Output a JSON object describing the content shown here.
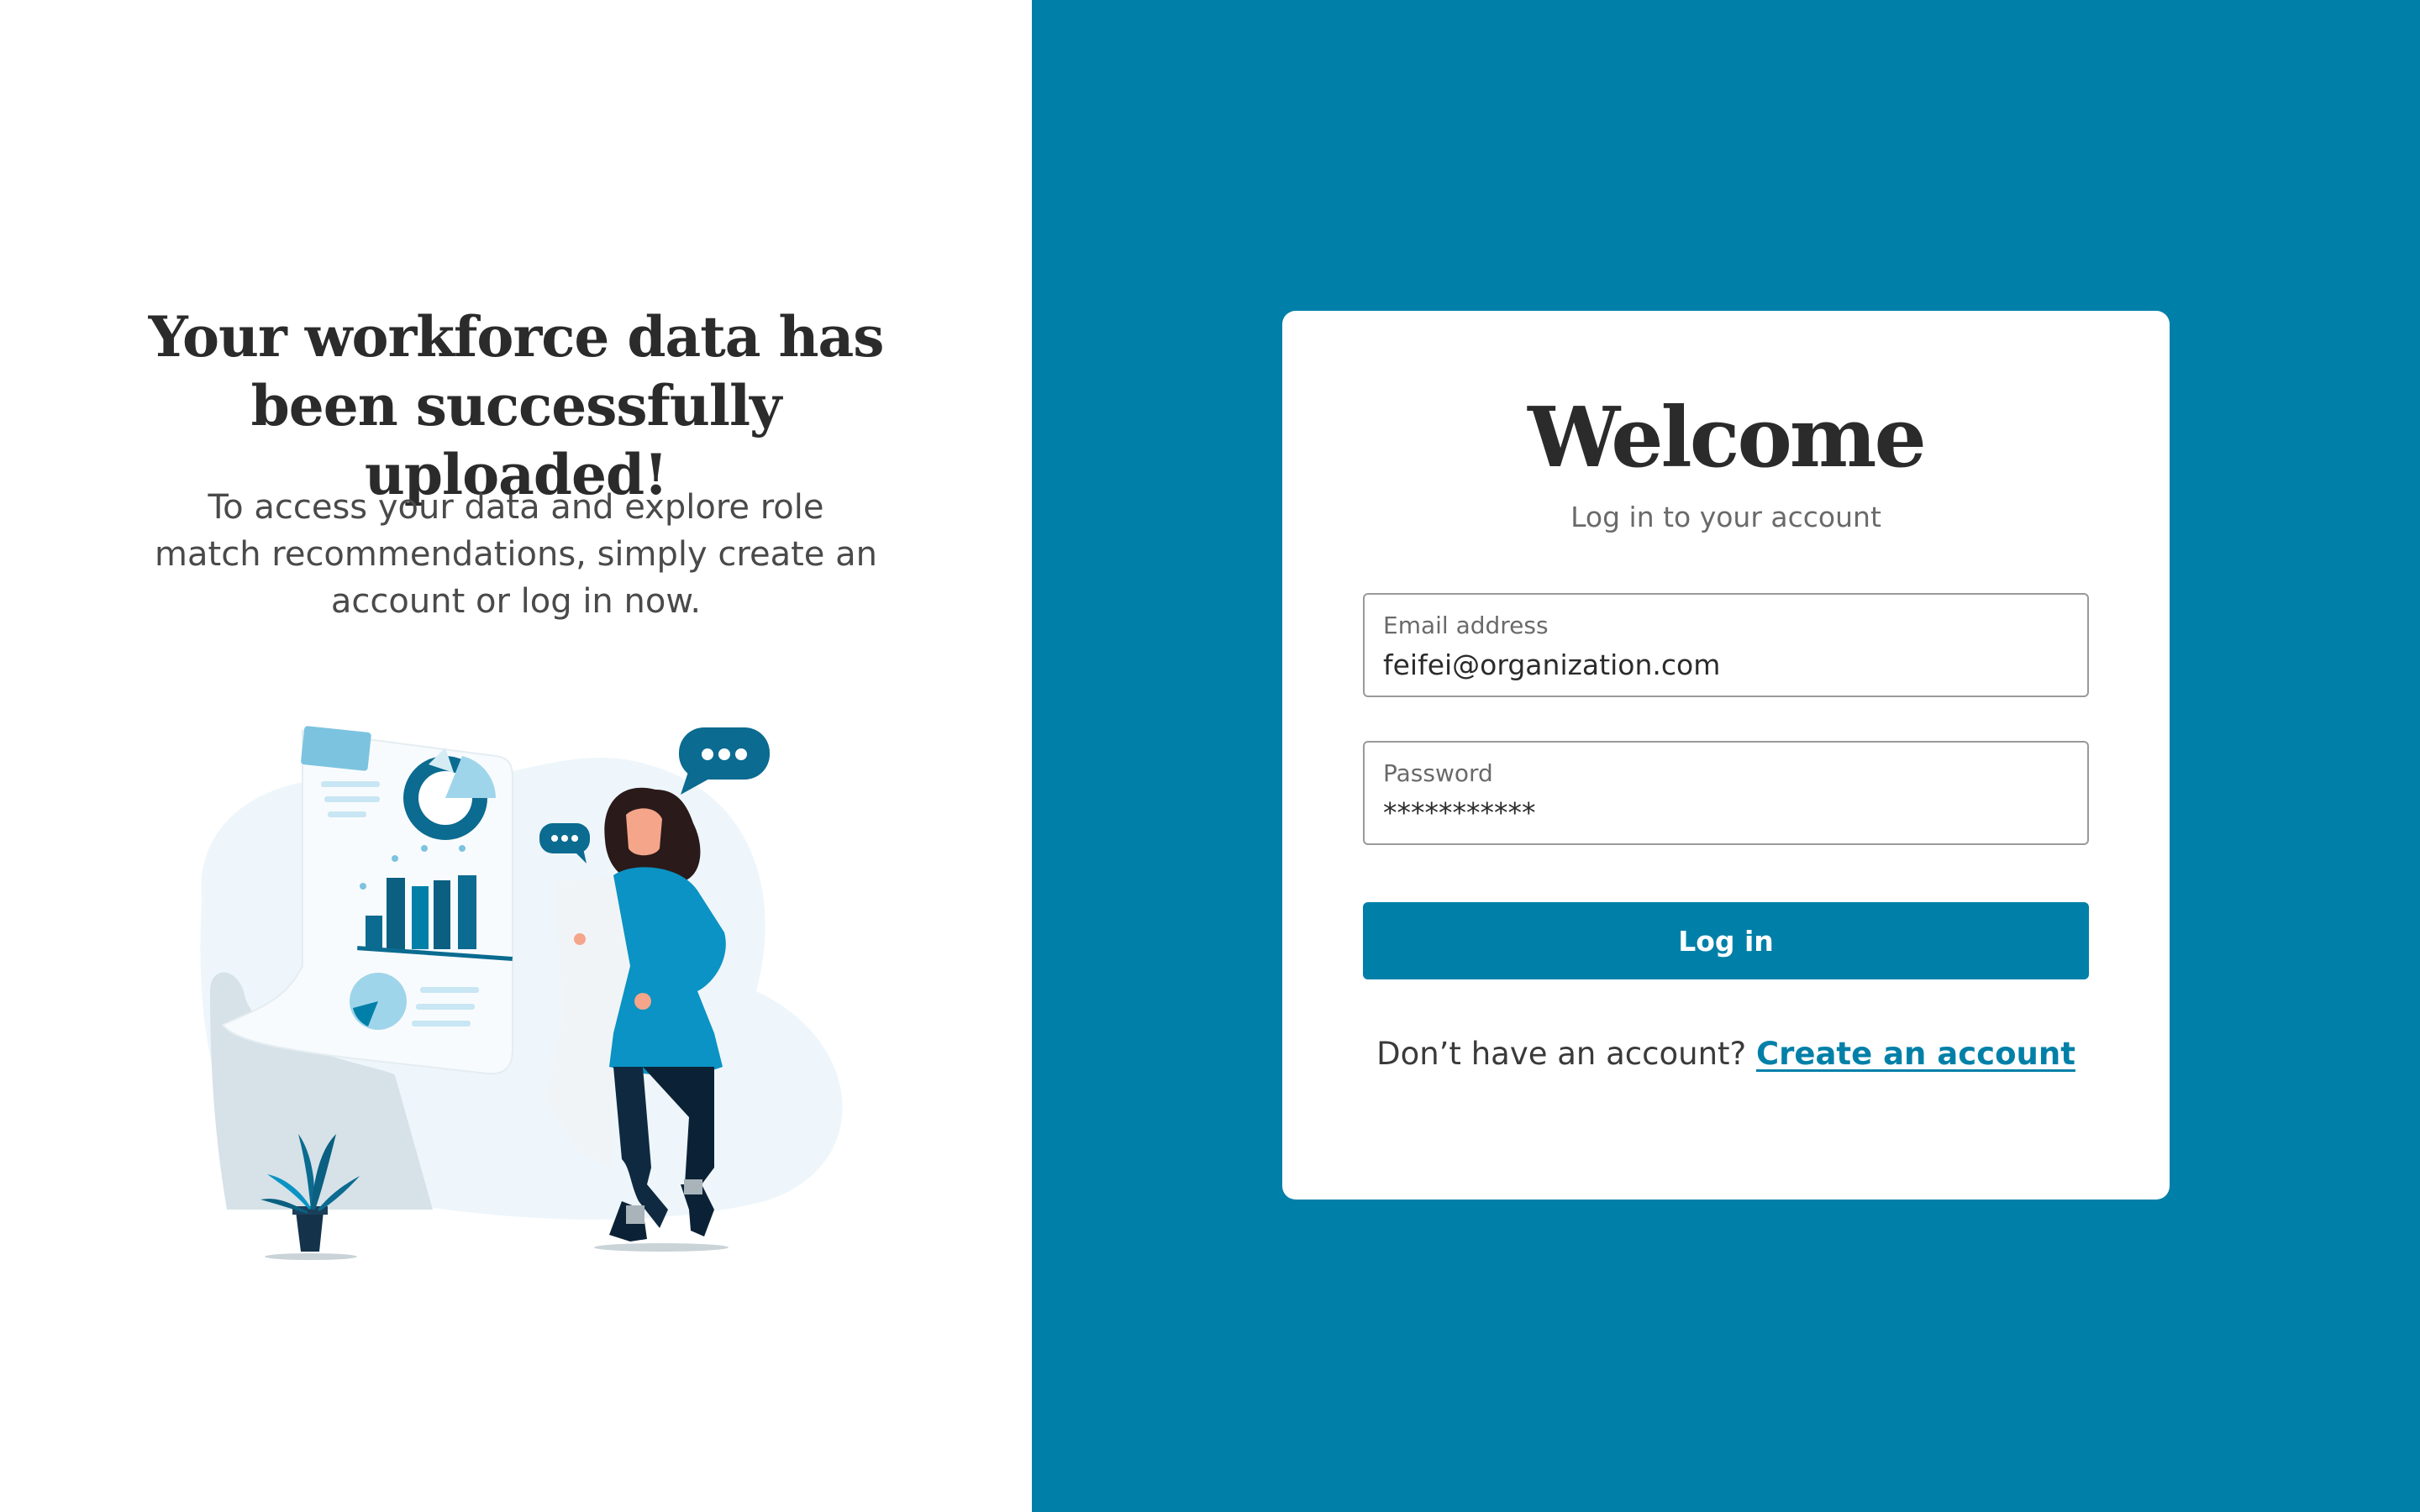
{
  "left": {
    "headline": "Your workforce data has been successfully uploaded!",
    "subtext": "To access your data and explore role match recommendations, simply create an account or log in now."
  },
  "card": {
    "title": "Welcome",
    "subtitle": "Log in to your account",
    "email": {
      "label": "Email address",
      "value": "feifei@organization.com"
    },
    "password": {
      "label": "Password",
      "value": "***********"
    },
    "login_label": "Log in",
    "signup_prompt": "Don’t have an account?",
    "signup_link": "Create an account"
  },
  "colors": {
    "brand_blue": "#0080a8",
    "text_dark": "#2b2b2b",
    "text_muted": "#6a6a6a"
  },
  "illustration": {
    "icons": [
      "dashboard-document-icon",
      "chat-bubble-icon",
      "potted-plant-icon",
      "woman-reading-figure"
    ]
  }
}
